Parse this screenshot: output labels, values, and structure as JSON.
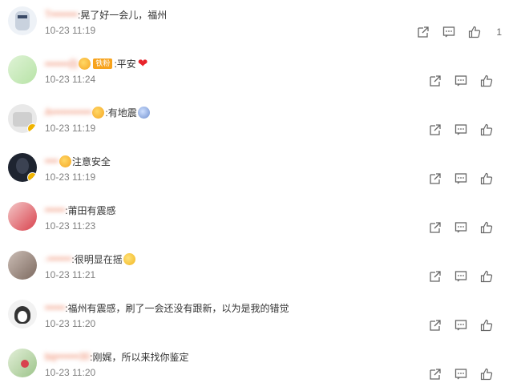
{
  "comments": [
    {
      "name": "T••••••••",
      "text": ":晃了好一会儿，福州",
      "time": "10-23 11:19",
      "likes": "1",
      "emoji": "",
      "emoji2": ""
    },
    {
      "name": "•••••••白",
      "text": ":平安",
      "time": "10-23 11:24",
      "likes": "",
      "emoji": "face",
      "emoji2": "heart",
      "badge": "铁粉"
    },
    {
      "name": "A••••••••••••",
      "text": ":有地震",
      "time": "10-23 11:19",
      "likes": "",
      "emoji": "face",
      "emoji2": "scared"
    },
    {
      "name": "••••",
      "text": "注意安全",
      "time": "10-23 11:19",
      "likes": "",
      "emoji": "face",
      "emoji2": ""
    },
    {
      "name": "••••••",
      "text": ":莆田有震感",
      "time": "10-23 11:23",
      "likes": "",
      "emoji": "",
      "emoji2": ""
    },
    {
      "name": "-•••••••",
      "text": ":很明显在摇",
      "time": "10-23 11:21",
      "likes": "",
      "emoji": "",
      "emoji2": "think"
    },
    {
      "name": "••••••",
      "text": ":福州有震感，刷了一会还没有跟新，以为是我的错觉",
      "time": "10-23 11:20",
      "likes": "",
      "emoji": "",
      "emoji2": ""
    },
    {
      "name": "bq•••••••30",
      "text": ":刚娓，所以来找你鉴定",
      "time": "10-23 11:20",
      "likes": "",
      "emoji": "",
      "emoji2": ""
    }
  ],
  "colors": {
    "name": "#eb7350",
    "text": "#333333",
    "time": "#808080",
    "icon": "#666666"
  },
  "icons": [
    "share-icon",
    "comment-icon",
    "like-icon"
  ]
}
